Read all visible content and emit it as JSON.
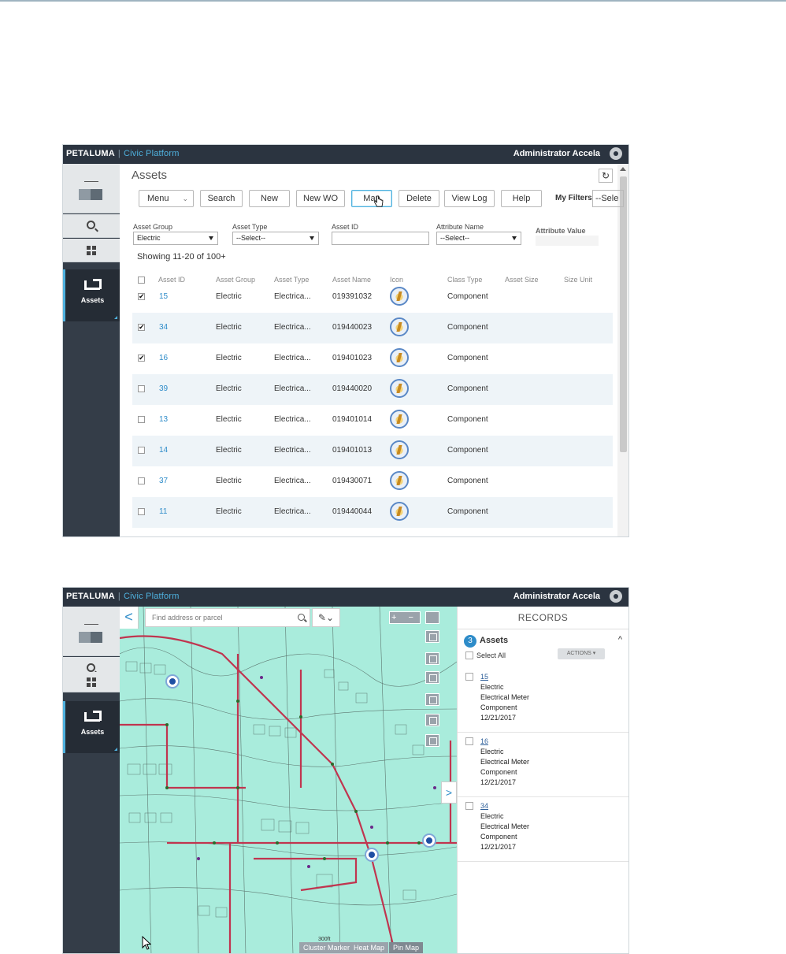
{
  "app": {
    "brand": "PETALUMA",
    "separator": "|",
    "platform": "Civic Platform",
    "user": "Administrator Accela"
  },
  "sidebar": {
    "assets_label": "Assets"
  },
  "assets_screen": {
    "title": "Assets",
    "toolbar": {
      "menu": "Menu",
      "search": "Search",
      "new": "New",
      "new_wo": "New WO",
      "map": "Map",
      "delete": "Delete",
      "view_log": "View Log",
      "help": "Help"
    },
    "my_filters_label": "My Filters",
    "my_filters_value": "--Sele",
    "filters": {
      "asset_group_label": "Asset Group",
      "asset_group_value": "Electric",
      "asset_type_label": "Asset Type",
      "asset_type_value": "--Select--",
      "asset_id_label": "Asset ID",
      "asset_id_value": "",
      "attribute_name_label": "Attribute Name",
      "attribute_name_value": "--Select--",
      "attribute_value_label": "Attribute Value"
    },
    "showing": "Showing 11-20 of 100+",
    "columns": [
      "Asset ID",
      "Asset Group",
      "Asset Type",
      "Asset Name",
      "Icon",
      "Class Type",
      "Asset Size",
      "Size Unit"
    ],
    "rows": [
      {
        "checked": true,
        "id": "15",
        "group": "Electric",
        "type": "Electrica...",
        "name": "019391032",
        "class": "Component"
      },
      {
        "checked": true,
        "id": "34",
        "group": "Electric",
        "type": "Electrica...",
        "name": "019440023",
        "class": "Component"
      },
      {
        "checked": true,
        "id": "16",
        "group": "Electric",
        "type": "Electrica...",
        "name": "019401023",
        "class": "Component"
      },
      {
        "checked": false,
        "id": "39",
        "group": "Electric",
        "type": "Electrica...",
        "name": "019440020",
        "class": "Component"
      },
      {
        "checked": false,
        "id": "13",
        "group": "Electric",
        "type": "Electrica...",
        "name": "019401014",
        "class": "Component"
      },
      {
        "checked": false,
        "id": "14",
        "group": "Electric",
        "type": "Electrica...",
        "name": "019401013",
        "class": "Component"
      },
      {
        "checked": false,
        "id": "37",
        "group": "Electric",
        "type": "Electrica...",
        "name": "019430071",
        "class": "Component"
      },
      {
        "checked": false,
        "id": "11",
        "group": "Electric",
        "type": "Electrica...",
        "name": "019440044",
        "class": "Component"
      }
    ],
    "check_glyph": "✔",
    "refresh_glyph": "↻"
  },
  "map_screen": {
    "search_placeholder": "Find address or parcel",
    "back_glyph": "<",
    "expand_glyph": ">",
    "zoom_controls": "+ −",
    "footer": {
      "cluster": "Cluster Marker",
      "heat": "Heat Map",
      "pin": "Pin Map",
      "scale": "300ft"
    },
    "records": {
      "title": "RECORDS",
      "count": "3",
      "group": "Assets",
      "select_all": "Select All",
      "actions": "ACTIONS ▾",
      "items": [
        {
          "id": "15",
          "group": "Electric",
          "type": "Electrical Meter",
          "class": "Component",
          "date": "12/21/2017"
        },
        {
          "id": "16",
          "group": "Electric",
          "type": "Electrical Meter",
          "class": "Component",
          "date": "12/21/2017"
        },
        {
          "id": "34",
          "group": "Electric",
          "type": "Electrical Meter",
          "class": "Component",
          "date": "12/21/2017"
        }
      ]
    }
  },
  "colors": {
    "app_bar": "#2b3440",
    "accent": "#4fb2df",
    "link": "#2e8cc9",
    "map_land": "#a9ecdc",
    "map_road": "#c0354f",
    "pin": "#1f4fa3"
  }
}
